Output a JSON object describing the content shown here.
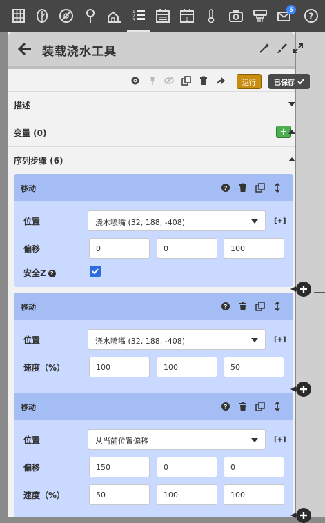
{
  "nav": {
    "icons": [
      "grid-icon",
      "leaf-icon",
      "weeds-icon",
      "point-icon",
      "farm-icon",
      "sequence-icon",
      "calendar-icon",
      "event-icon",
      "thermometer-icon",
      "camera-icon",
      "device-icon",
      "messages-icon",
      "help-icon"
    ],
    "messages_badge": "5"
  },
  "panel": {
    "title": "装载浇水工具",
    "run_label": "运行",
    "save_label": "已保存"
  },
  "sections": {
    "description": "描述",
    "variables": "变量 (0)",
    "steps": "序列步骤 (6)"
  },
  "steps": [
    {
      "title": "移动",
      "location_label": "位置",
      "location_value": "浇水喷嘴 (32, 188, -408)",
      "add_link": "[+]",
      "offset_label": "偏移",
      "offset": [
        "0",
        "0",
        "100"
      ],
      "safe_z_label": "安全Z",
      "safe_z_checked": true
    },
    {
      "title": "移动",
      "location_label": "位置",
      "location_value": "浇水喷嘴 (32, 188, -408)",
      "add_link": "[+]",
      "speed_label": "速度（%）",
      "speed": [
        "100",
        "100",
        "50"
      ]
    },
    {
      "title": "移动",
      "location_label": "位置",
      "location_value": "从当前位置偏移",
      "add_link": "[+]",
      "offset_label": "偏移",
      "offset": [
        "150",
        "0",
        "0"
      ],
      "speed_label": "速度（%）",
      "speed": [
        "50",
        "100",
        "100"
      ]
    }
  ],
  "colors": {
    "nav_bg": "#464646",
    "step_header": "#a4bdf5",
    "step_body": "#c9d9ff",
    "run_button": "#c88e14",
    "add_variable": "#4caf50",
    "checkbox": "#2b6de0"
  }
}
